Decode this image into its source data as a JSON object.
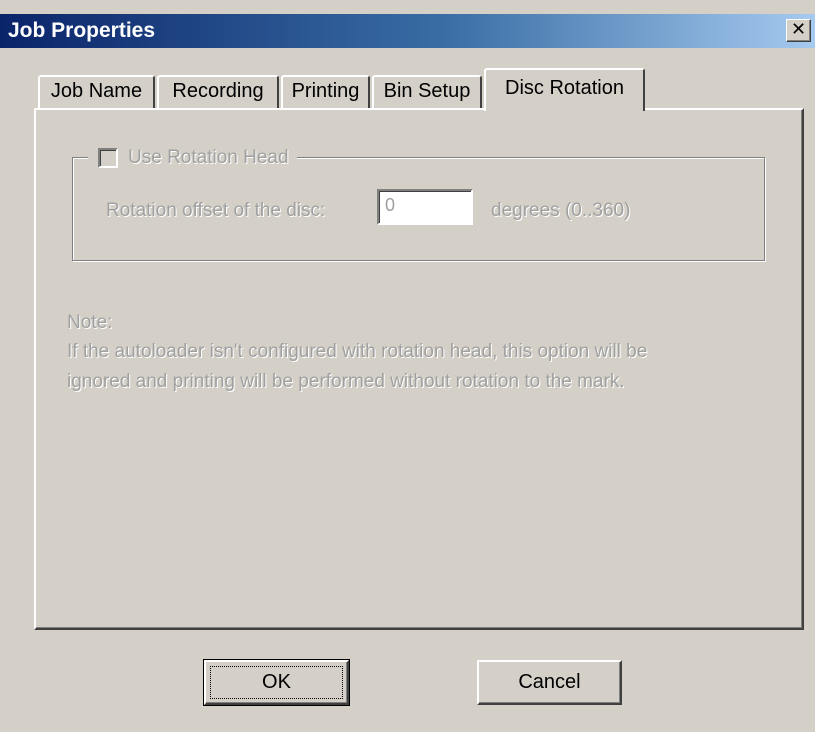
{
  "window": {
    "title": "Job Properties",
    "close_glyph": "✕",
    "close_icon": "close-icon"
  },
  "tabs": [
    {
      "label": "Job Name",
      "selected": false
    },
    {
      "label": "Recording",
      "selected": false
    },
    {
      "label": "Printing",
      "selected": false
    },
    {
      "label": "Bin Setup",
      "selected": false
    },
    {
      "label": "Disc Rotation",
      "selected": true
    }
  ],
  "rotation": {
    "checkbox_label": "Use Rotation Head",
    "checked": false,
    "enabled": false,
    "offset_label": "Rotation offset of the disc:",
    "offset_value": "0",
    "units_label": "degrees  (0..360)"
  },
  "note": {
    "title": "Note:",
    "line1": "If the autoloader isn't configured with rotation head, this option will be",
    "line2": "ignored and printing will be performed without rotation to the mark."
  },
  "buttons": {
    "ok_label": "OK",
    "cancel_label": "Cancel"
  },
  "colors": {
    "dialog_bg": "#d4d0c8",
    "titlebar_start": "#0a246a",
    "titlebar_end": "#a6caf0",
    "disabled_text": "#a0a0a0"
  }
}
